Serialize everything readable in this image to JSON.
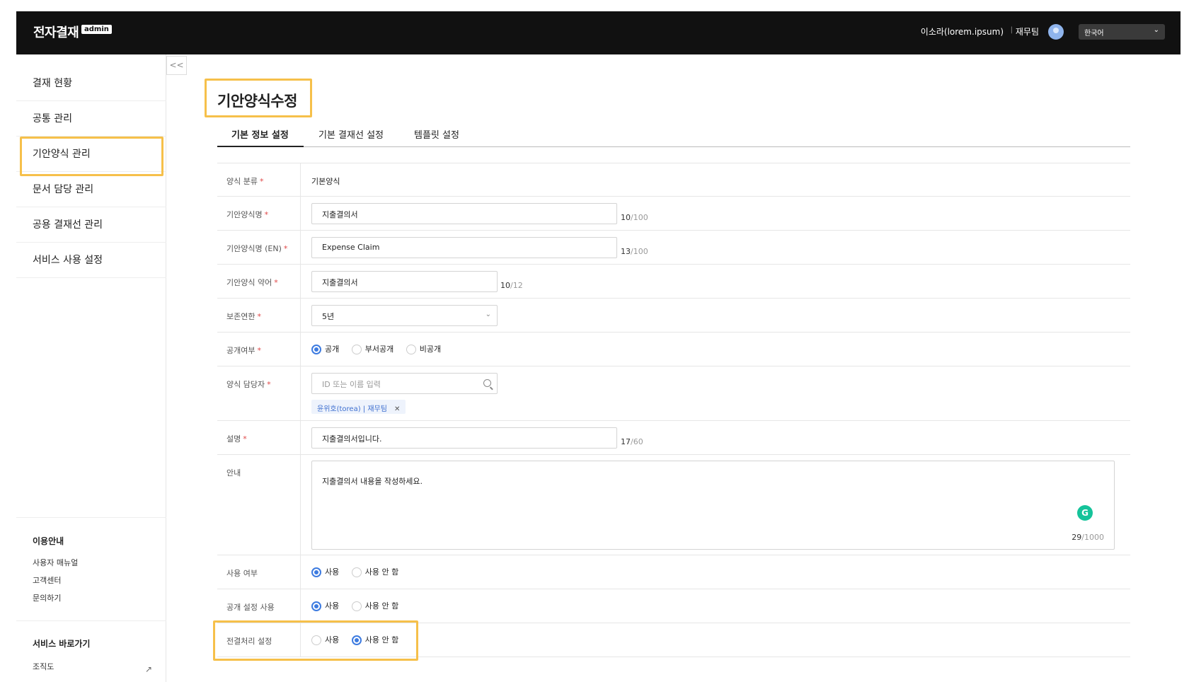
{
  "header": {
    "brand": "전자결재",
    "badge": "admin",
    "user_name": "이소라(lorem.ipsum)",
    "separator": "|",
    "team": "재무팀",
    "language": "한국어"
  },
  "sidebar": {
    "items": [
      {
        "label": "결재 현황"
      },
      {
        "label": "공통 관리"
      },
      {
        "label": "기안양식 관리"
      },
      {
        "label": "문서 담당 관리"
      },
      {
        "label": "공용 결재선 관리"
      },
      {
        "label": "서비스 사용 설정"
      }
    ],
    "collapse_label": "<<",
    "help": {
      "title": "이용안내",
      "links": [
        "사용자 매뉴얼",
        "고객센터",
        "문의하기"
      ]
    },
    "shortcuts": {
      "title": "서비스 바로가기",
      "links": [
        "조직도"
      ]
    }
  },
  "page": {
    "title": "기안양식수정",
    "tabs": [
      "기본 정보 설정",
      "기본 결재선 설정",
      "템플릿 설정"
    ]
  },
  "form": {
    "category": {
      "label": "양식 분류",
      "value": "기본양식"
    },
    "name": {
      "label": "기안양식명",
      "value": "지출결의서",
      "count": "10",
      "max": "/100"
    },
    "name_en": {
      "label": "기안양식명 (EN)",
      "value": "Expense Claim",
      "count": "13",
      "max": "/100"
    },
    "abbr": {
      "label": "기안양식 약어",
      "value": "지출결의서",
      "count": "10",
      "max": "/12"
    },
    "retention": {
      "label": "보존연한",
      "value": "5년"
    },
    "visibility": {
      "label": "공개여부",
      "options": [
        "공개",
        "부서공개",
        "비공개"
      ],
      "selected": "공개"
    },
    "manager": {
      "label": "양식 담당자",
      "placeholder": "ID 또는 이름 입력",
      "chip": "윤위호(torea) | 재무팀"
    },
    "description": {
      "label": "설명",
      "value": "지출결의서입니다.",
      "count": "17",
      "max": "/60"
    },
    "guide": {
      "label": "안내",
      "value": "지출결의서 내용을 작성하세요.",
      "count": "29",
      "max": "/1000",
      "grammarly": "G"
    },
    "use": {
      "label": "사용 여부",
      "options": [
        "사용",
        "사용 안 함"
      ],
      "selected": "사용"
    },
    "public_setting": {
      "label": "공개 설정 사용",
      "options": [
        "사용",
        "사용 안 함"
      ],
      "selected": "사용"
    },
    "prior_approval": {
      "label": "전결처리 설정",
      "options": [
        "사용",
        "사용 안 함"
      ],
      "selected": "사용 안 함"
    },
    "required_mark": "*"
  },
  "colors": {
    "accent": "#3d7be0",
    "highlight": "#f6c04a",
    "header_bg": "#111111"
  }
}
